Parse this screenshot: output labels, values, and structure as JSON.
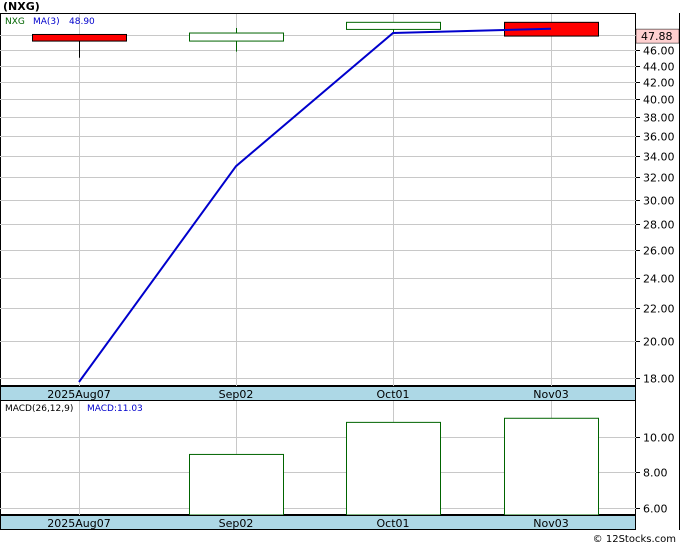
{
  "chart_data": [
    {
      "type": "candlestick",
      "title": "(NXG)",
      "legend": [
        {
          "label": "NXG",
          "color": "#006400"
        },
        {
          "label": "MA(3)",
          "color": "#0000cc"
        },
        {
          "label": "48.90",
          "color": "#0000cc"
        }
      ],
      "categories": [
        "2025Aug07",
        "Sep02",
        "Oct01",
        "Nov03"
      ],
      "candles": [
        {
          "open": 48.1,
          "close": 47.2,
          "high": 48.1,
          "low": 45.0,
          "direction": "down"
        },
        {
          "open": 47.2,
          "close": 48.3,
          "high": 49.0,
          "low": 45.8,
          "direction": "up"
        },
        {
          "open": 48.8,
          "close": 49.8,
          "high": 49.8,
          "low": 48.2,
          "direction": "up"
        },
        {
          "open": 49.8,
          "close": 47.88,
          "high": 49.8,
          "low": 47.88,
          "direction": "down"
        }
      ],
      "series": [
        {
          "name": "MA(3)",
          "values": [
            17.8,
            33.0,
            48.3,
            48.9
          ],
          "color": "#0000cc"
        }
      ],
      "y_ticks": [
        18.0,
        20.0,
        22.0,
        24.0,
        26.0,
        28.0,
        30.0,
        32.0,
        34.0,
        36.0,
        38.0,
        40.0,
        42.0,
        44.0,
        46.0,
        48.0
      ],
      "y_tick_labels": [
        "18.00",
        "20.00",
        "22.00",
        "24.00",
        "26.00",
        "28.00",
        "30.00",
        "32.00",
        "34.00",
        "36.00",
        "38.00",
        "40.00",
        "42.00",
        "44.00",
        "46.00",
        "48.00"
      ],
      "scale": "log",
      "ylim": [
        17.6,
        51.0
      ],
      "last_price": "47.88",
      "grid": true
    },
    {
      "type": "bar",
      "title": "MACD(26,12,9)",
      "legend": [
        {
          "label": "MACD(26,12,9)",
          "color": "#000000"
        },
        {
          "label": "MACD:11.03",
          "color": "#0000cc"
        }
      ],
      "categories": [
        "2025Aug07",
        "Sep02",
        "Oct01",
        "Nov03"
      ],
      "values": [
        null,
        9.0,
        10.8,
        11.03
      ],
      "y_ticks": [
        6.0,
        8.0,
        10.0
      ],
      "y_tick_labels": [
        "6.00",
        "8.00",
        "10.00"
      ],
      "ylim": [
        5.6,
        12.0
      ],
      "grid": true
    }
  ],
  "footer": {
    "copyright": "© 12Stocks.com"
  },
  "colors": {
    "axis_band": "#add8e6",
    "up_candle": "#006400",
    "down_candle": "#ff0000",
    "ma_line": "#0000cc",
    "price_label_bg": "#ffd0d0",
    "grid": "#c8c8c8"
  }
}
